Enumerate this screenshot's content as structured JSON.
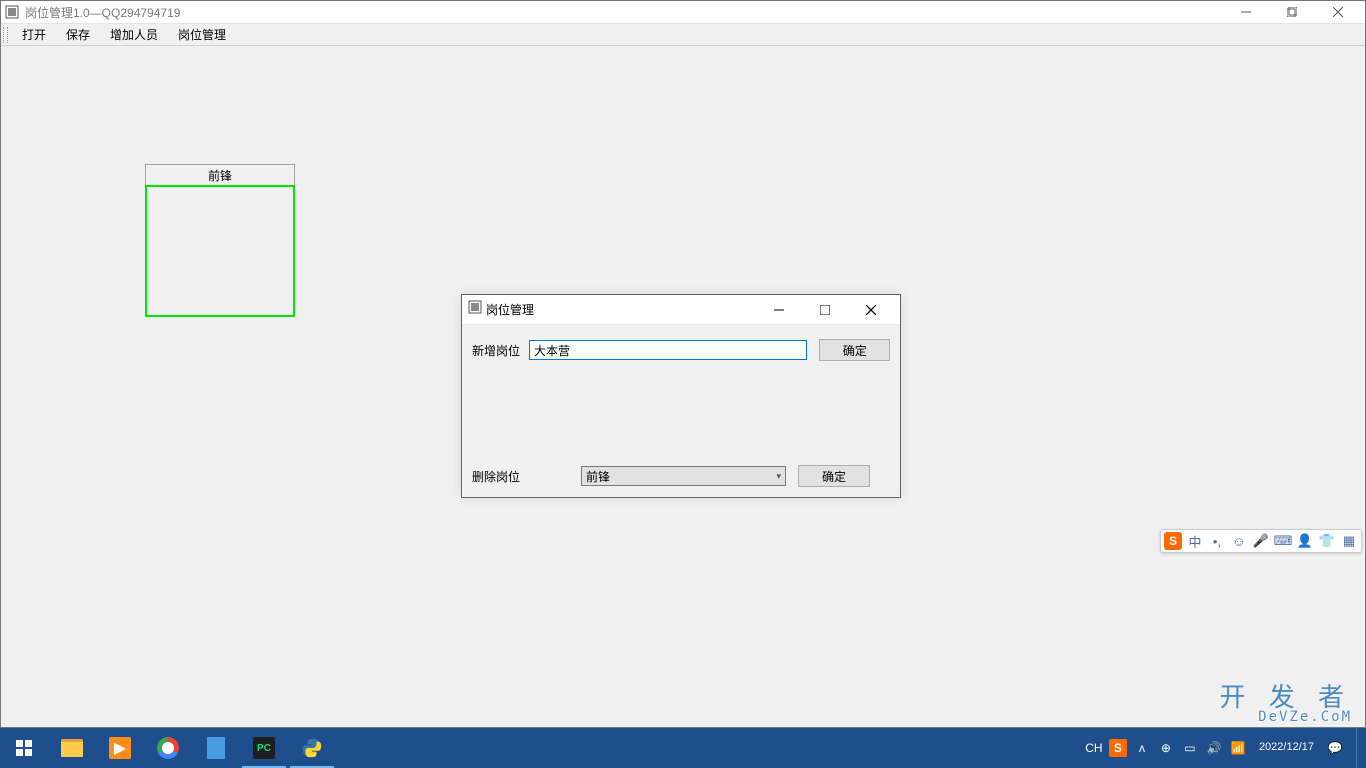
{
  "mainWindow": {
    "title": "岗位管理1.0—QQ294794719"
  },
  "menu": {
    "open": "打开",
    "save": "保存",
    "addPerson": "增加人员",
    "positionManage": "岗位管理"
  },
  "positionBox": {
    "header": "前锋"
  },
  "dialog": {
    "title": "岗位管理",
    "addLabel": "新增岗位",
    "addValue": "大本营",
    "addButton": "确定",
    "delLabel": "删除岗位",
    "delSelected": "前锋",
    "delButton": "确定"
  },
  "ime": {
    "s": "S",
    "lang": "中"
  },
  "taskbar": {
    "lang": "CH",
    "time": "2022/12/17"
  },
  "watermark": {
    "main": "开 发 者",
    "sub": "DeVZe.CoM"
  }
}
